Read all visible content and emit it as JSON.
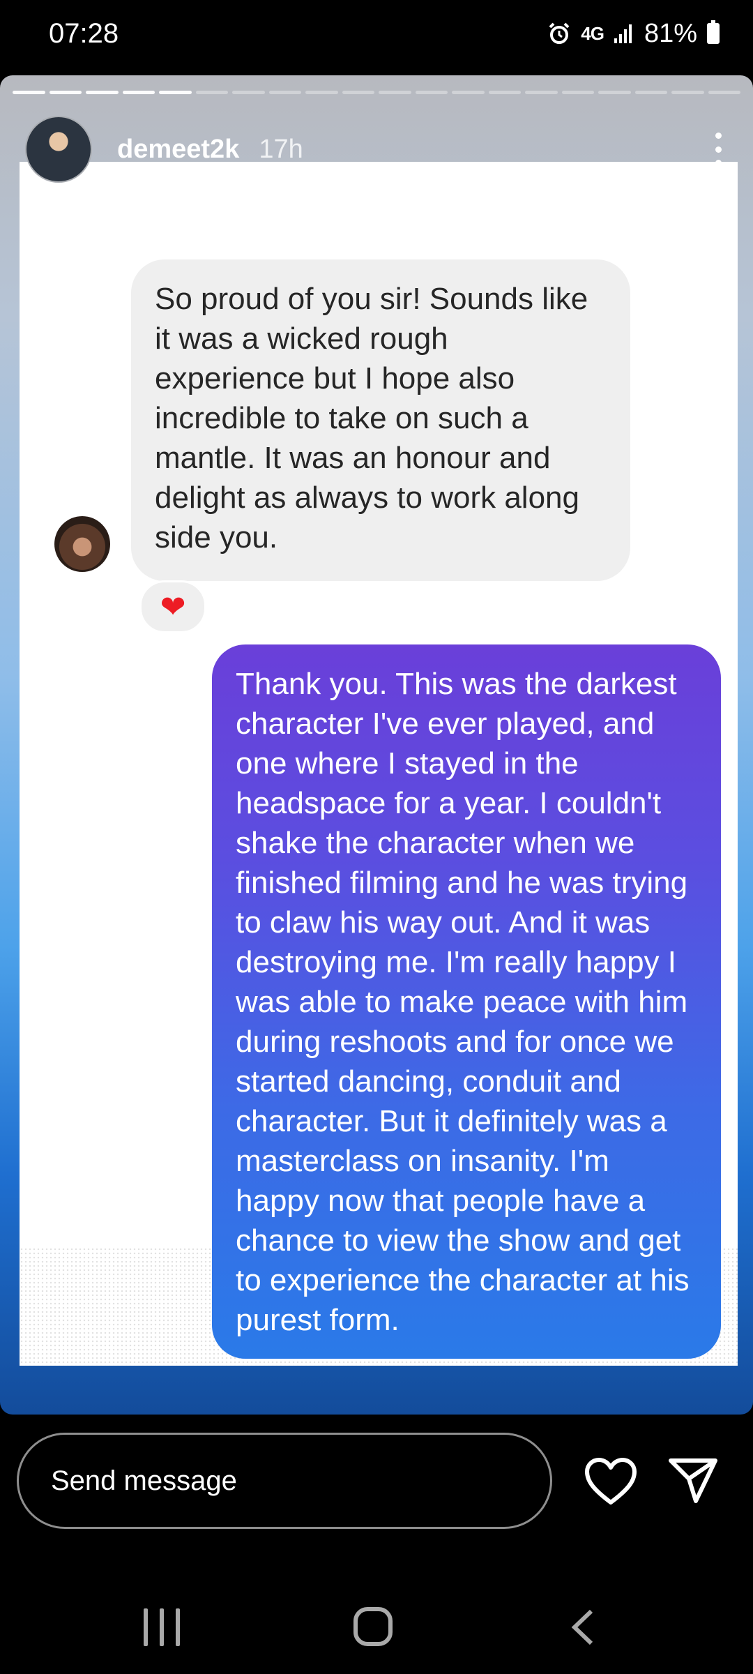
{
  "status_bar": {
    "time": "07:28",
    "network": "4G",
    "battery": "81%",
    "icons": [
      "alarm-icon",
      "signal-icon",
      "battery-icon"
    ]
  },
  "story": {
    "username": "demeet2k",
    "time_ago": "17h",
    "progress_segments_total": 20,
    "progress_segments_done": 5
  },
  "chat": {
    "incoming_message": "So proud of you sir! Sounds like it was a wicked rough experience but I hope also incredible to take on such a mantle. It was an honour and delight as always to work along side you.",
    "reaction": "❤",
    "outgoing_message": "Thank you. This was the darkest character I've ever played, and one where I stayed in the headspace for a year. I couldn't shake the character when we finished filming and he was trying to claw his way out. And it was destroying me. I'm really happy I was able to make peace with him during reshoots and for once we started dancing, conduit and character. But it definitely was a masterclass on insanity. I'm happy now that people have a chance to view the show and get to experience the character at his purest form."
  },
  "footer": {
    "message_placeholder": "Send message"
  },
  "colors": {
    "outgoing_bubble_top": "#6a3fd9",
    "outgoing_bubble_bottom": "#2a7ae8",
    "incoming_bubble": "#efefef",
    "reaction_heart": "#ed1c24"
  }
}
